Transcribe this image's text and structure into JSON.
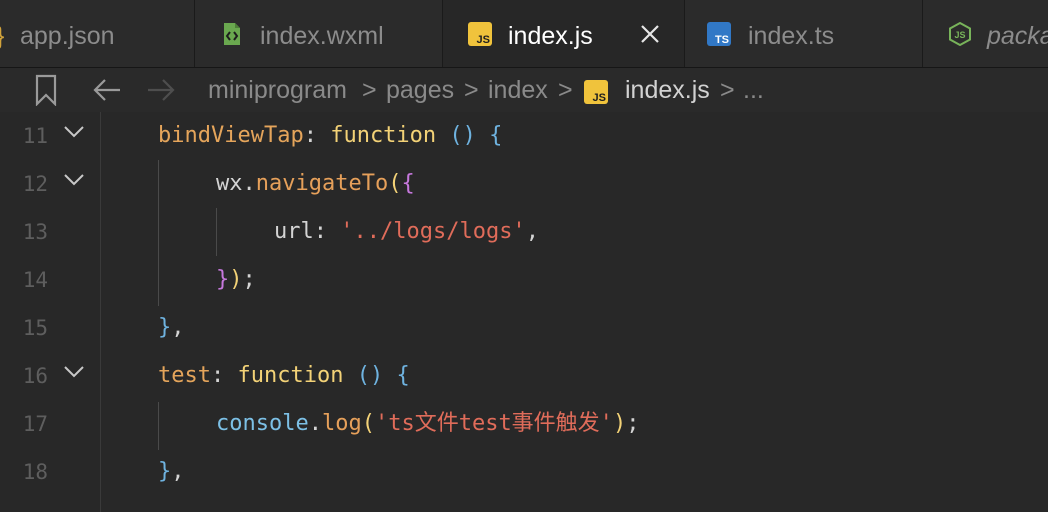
{
  "tabs": [
    {
      "label": "app.json",
      "icon": "json-braces-icon",
      "active": false
    },
    {
      "label": "index.wxml",
      "icon": "wxml-file-icon",
      "active": false
    },
    {
      "label": "index.js",
      "icon": "js-file-icon",
      "active": true
    },
    {
      "label": "index.ts",
      "icon": "ts-file-icon",
      "active": false
    },
    {
      "label": "packa",
      "icon": "nodejs-icon",
      "active": false
    }
  ],
  "icons": {
    "js_text": "JS",
    "ts_text": "TS",
    "js_badge_text": "JS"
  },
  "breadcrumb": {
    "items": [
      "miniprogram",
      "pages",
      "index",
      "index.js",
      "..."
    ],
    "separator": ">"
  },
  "editor": {
    "line_numbers": [
      "11",
      "12",
      "13",
      "14",
      "15",
      "16",
      "17",
      "18"
    ],
    "code": {
      "l11": {
        "prop": "bindViewTap",
        "colon": ": ",
        "kw": "function",
        "sp": " ",
        "parens": "()",
        "sp2": " ",
        "brace": "{"
      },
      "l12": {
        "obj": "wx",
        "dot": ".",
        "fn": "navigateTo",
        "paren": "(",
        "brace": "{"
      },
      "l13": {
        "key": "url",
        "colon": ": ",
        "str": "'../logs/logs'",
        "comma": ","
      },
      "l14": {
        "brace": "}",
        "paren": ")",
        "semi": ";"
      },
      "l15": {
        "brace": "}",
        "comma": ","
      },
      "l16": {
        "prop": "test",
        "colon": ": ",
        "kw": "function",
        "sp": " ",
        "parens": "()",
        "sp2": " ",
        "brace": "{"
      },
      "l17": {
        "obj": "console",
        "dot": ".",
        "fn": "log",
        "paren": "(",
        "str": "'ts文件test事件触发'",
        "paren_close": ")",
        "semi": ";"
      },
      "l18": {
        "brace": "}",
        "comma": ","
      }
    }
  },
  "colors": {
    "background": "#282828",
    "tab_background": "#1e1e1e",
    "property": "#e5a55b",
    "keyword": "#f3d277",
    "string": "#e06c5a",
    "paren": "#6fb3e0",
    "brace_magenta": "#c678dd",
    "js_icon": "#f0c33c",
    "ts_icon": "#3178c6",
    "wxml_icon": "#6aa84f",
    "node_icon": "#78b35a"
  }
}
